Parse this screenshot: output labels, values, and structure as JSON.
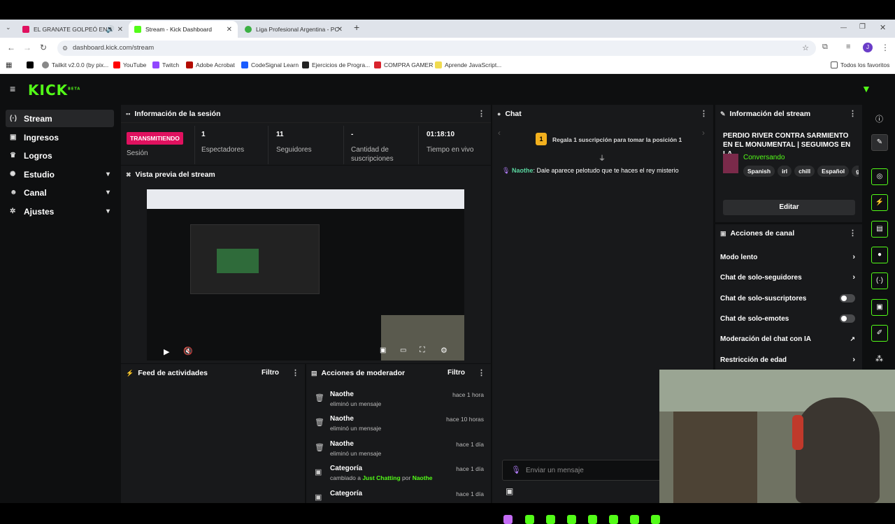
{
  "browser": {
    "tabs": [
      {
        "title": "EL GRANATE GOLPEÓ EN A",
        "favicon_color": "#e0115f"
      },
      {
        "title": "Stream - Kick Dashboard",
        "favicon_color": "#53fc18"
      },
      {
        "title": "Liga Profesional Argentina - PC",
        "favicon_color": "#3cb043"
      }
    ],
    "new_tab": "+",
    "url": "dashboard.kick.com/stream",
    "profile_initial": "J",
    "bookmarks": [
      {
        "label": "",
        "color": "#000000"
      },
      {
        "label": "Tailkit v2.0.0 (by pix...",
        "color": "#888888"
      },
      {
        "label": "YouTube",
        "color": "#ff0000"
      },
      {
        "label": "Twitch",
        "color": "#9146ff"
      },
      {
        "label": "Adobe Acrobat",
        "color": "#b30b00"
      },
      {
        "label": "CodeSignal Learn",
        "color": "#1a5cff"
      },
      {
        "label": "Ejercicios de Progra...",
        "color": "#222222"
      },
      {
        "label": "COMPRA GAMER",
        "color": "#d9232d"
      },
      {
        "label": "Aprende JavaScript...",
        "color": "#f0db4f"
      }
    ],
    "all_bookmarks": "Todos los favoritos"
  },
  "app": {
    "logo": "KICK",
    "logo_beta": "BETA",
    "sidebar": {
      "items": [
        {
          "label": "Stream",
          "icon": "broadcast-icon"
        },
        {
          "label": "Ingresos",
          "icon": "dollar-icon"
        },
        {
          "label": "Logros",
          "icon": "trophy-icon"
        },
        {
          "label": "Estudio",
          "icon": "studio-icon"
        },
        {
          "label": "Canal",
          "icon": "user-icon"
        },
        {
          "label": "Ajustes",
          "icon": "gear-icon"
        }
      ]
    },
    "session": {
      "title": "Información de la sesión",
      "status": "TRANSMITIENDO",
      "status_label": "Sesión",
      "stats": [
        {
          "value": "1",
          "label": "Espectadores"
        },
        {
          "value": "11",
          "label": "Seguidores"
        },
        {
          "value": "-",
          "label": "Cantidad de suscripciones"
        },
        {
          "value": "01:18:10",
          "label": "Tiempo en vivo"
        }
      ]
    },
    "preview": {
      "title": "Vista previa del stream"
    },
    "feed": {
      "title": "Feed de actividades",
      "filter": "Filtro"
    },
    "mod": {
      "title": "Acciones de moderador",
      "filter": "Filtro",
      "rows": [
        {
          "who": "Naothe",
          "what": "eliminó un mensaje",
          "when": "hace 1 hora",
          "icon": "trash-icon"
        },
        {
          "who": "Naothe",
          "what": "eliminó un mensaje",
          "when": "hace 10 horas",
          "icon": "trash-icon"
        },
        {
          "who": "Naothe",
          "what": "eliminó un mensaje",
          "when": "hace 1 día",
          "icon": "trash-icon"
        },
        {
          "who": "Categoría",
          "what_prefix": "cambiado a",
          "category": "Just Chatting",
          "by": "por",
          "user": "Naothe",
          "when": "hace 1 día",
          "icon": "category-icon"
        },
        {
          "who": "Categoría",
          "what": "",
          "when": "hace 1 día",
          "icon": "category-icon"
        }
      ]
    },
    "chat": {
      "title": "Chat",
      "gift_banner": "Regala 1 suscripción para tomar la posición 1",
      "gift_rank": "1",
      "messages": [
        {
          "user": "Naothe",
          "text": "Dale aparece pelotudo que te haces el rey misterio"
        }
      ],
      "input_placeholder": "Enviar un mensaje"
    },
    "stream_info": {
      "title": "Información del stream",
      "stream_title": "PERDIO RIVER CONTRA SARMIENTO EN EL MONUMENTAL | SEGUIMOS EN LA...",
      "category": "Conversando",
      "tags": [
        "Spanish",
        "irl",
        "chill",
        "Español",
        "ga"
      ],
      "edit": "Editar"
    },
    "channel_actions": {
      "title": "Acciones de canal",
      "items": [
        {
          "label": "Modo lento",
          "control": "arrow"
        },
        {
          "label": "Chat de solo-seguidores",
          "control": "arrow"
        },
        {
          "label": "Chat de solo-suscriptores",
          "control": "toggle"
        },
        {
          "label": "Chat de solo-emotes",
          "control": "toggle"
        },
        {
          "label": "Moderación del chat con IA",
          "control": "external"
        },
        {
          "label": "Restricción de edad",
          "control": "arrow"
        }
      ]
    },
    "colors": {
      "accent": "#53fc18",
      "live": "#e0115f",
      "panel": "#18191b",
      "bg": "#0e0f10"
    }
  }
}
